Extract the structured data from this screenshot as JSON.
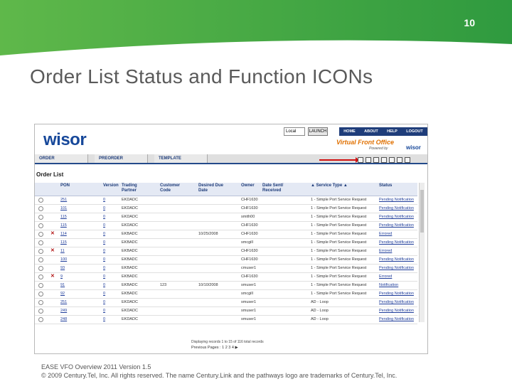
{
  "slide": {
    "number": "10",
    "title": "Order List Status and Function ICONs",
    "banner_color": "#3aa647",
    "footer_line1": "EASE VFO Overview 2011 Version 1.5",
    "footer_line2": "© 2009 Century.Tel, Inc. All rights reserved. The name Century.Link and the pathways logo are trademarks of Century.Tel, Inc."
  },
  "app": {
    "logo": "wisor",
    "local_select": "Local",
    "launch_label": "LAUNCH",
    "topnav": [
      "HOME",
      "ABOUT",
      "HELP",
      "LOGOUT"
    ],
    "brand": "Virtual Front Office",
    "powered_by": "Powered by",
    "brand_small": "wisor",
    "tabs": [
      "ORDER",
      "PREORDER",
      "TEMPLATE"
    ],
    "order_list_title": "Order List",
    "columns": [
      "PON",
      "Version",
      "Trading Partner",
      "Customer Code",
      "Desired Due Date",
      "Owner",
      "Date Sent/ Received",
      "▲ Service Type ▲",
      "Status"
    ],
    "rows": [
      {
        "pon": "251",
        "ver": "0",
        "tp": "EKDADC",
        "cc": "",
        "ddd": "",
        "owner": "CHF1630",
        "svc": "1 - Simple Port Service Request",
        "status": "Pending Notification",
        "x": false
      },
      {
        "pon": "101",
        "ver": "0",
        "tp": "EKDADC",
        "cc": "",
        "ddd": "",
        "owner": "CHF1630",
        "svc": "1 - Simple Port Service Request",
        "status": "Pending Notification",
        "x": false
      },
      {
        "pon": "115",
        "ver": "0",
        "tp": "EKDADC",
        "cc": "",
        "ddd": "",
        "owner": "smith00",
        "svc": "1 - Simple Port Service Request",
        "status": "Pending Notification",
        "x": false
      },
      {
        "pon": "115",
        "ver": "0",
        "tp": "EKDADC",
        "cc": "",
        "ddd": "",
        "owner": "CHF1630",
        "svc": "1 - Simple Port Service Request",
        "status": "Pending Notification",
        "x": false
      },
      {
        "pon": "114",
        "ver": "0",
        "tp": "EKBADC",
        "cc": "",
        "ddd": "10/25/2008",
        "owner": "CHF1630",
        "svc": "1 - Simple Port Service Request",
        "status": "Errored",
        "x": true
      },
      {
        "pon": "115",
        "ver": "0",
        "tp": "EKBADC",
        "cc": "",
        "ddd": "",
        "owner": "smcgill",
        "svc": "1 - Simple Port Service Request",
        "status": "Pending Notification",
        "x": false
      },
      {
        "pon": "11",
        "ver": "0",
        "tp": "EKBADC",
        "cc": "",
        "ddd": "",
        "owner": "CHF1630",
        "svc": "1 - Simple Port Service Request",
        "status": "Errored",
        "x": true
      },
      {
        "pon": "100",
        "ver": "0",
        "tp": "EKBADC",
        "cc": "",
        "ddd": "",
        "owner": "CHF1630",
        "svc": "1 - Simple Port Service Request",
        "status": "Pending Notification",
        "x": false
      },
      {
        "pon": "93",
        "ver": "0",
        "tp": "EKBADC",
        "cc": "",
        "ddd": "",
        "owner": "cmuser1",
        "svc": "1 - Simple Port Service Request",
        "status": "Pending Notification",
        "x": false
      },
      {
        "pon": "9",
        "ver": "0",
        "tp": "EKBADC",
        "cc": "",
        "ddd": "",
        "owner": "CHF1630",
        "svc": "1 - Simple Port Service Request",
        "status": "Errored",
        "x": true
      },
      {
        "pon": "91",
        "ver": "0",
        "tp": "EKBADC",
        "cc": "123",
        "ddd": "10/10/2008",
        "owner": "smuser1",
        "svc": "1 - Simple Port Service Request",
        "status": "Notification",
        "x": false
      },
      {
        "pon": "92",
        "ver": "0",
        "tp": "EKBADC",
        "cc": "",
        "ddd": "",
        "owner": "smcgill",
        "svc": "1 - Simple Port Service Request",
        "status": "Pending Notification",
        "x": false
      },
      {
        "pon": "251",
        "ver": "0",
        "tp": "EKDADC",
        "cc": "",
        "ddd": "",
        "owner": "smuser1",
        "svc": "AD - Loop",
        "status": "Pending Notification",
        "x": false
      },
      {
        "pon": "249",
        "ver": "0",
        "tp": "EKDADC",
        "cc": "",
        "ddd": "",
        "owner": "smuser1",
        "svc": "AD - Loop",
        "status": "Pending Notification",
        "x": false
      },
      {
        "pon": "248",
        "ver": "0",
        "tp": "EKDADC",
        "cc": "",
        "ddd": "",
        "owner": "smuser1",
        "svc": "AD - Loop",
        "status": "Pending Notification",
        "x": false
      }
    ],
    "pager_text": "Displaying records 1 to 15 of 116 total records",
    "pager_pages": "Previous Pages : 1 2 3 4 ▶"
  }
}
